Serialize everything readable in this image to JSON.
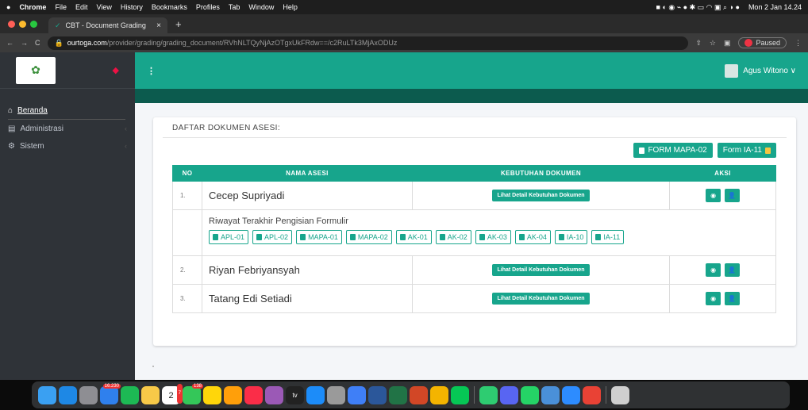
{
  "os_menu": {
    "items": [
      "Chrome",
      "File",
      "Edit",
      "View",
      "History",
      "Bookmarks",
      "Profiles",
      "Tab",
      "Window",
      "Help"
    ],
    "datetime": "Mon 2 Jan 14.24"
  },
  "browser": {
    "tab_title": "CBT - Document Grading",
    "url_domain": "ourtoga.com",
    "url_path": "/provider/grading/grading_document/RVhNLTQyNjAzOTgxUkFRdw==/c2RuLTk3MjAxODUz",
    "paused_label": "Paused"
  },
  "sidebar": {
    "items": [
      {
        "label": "Beranda"
      },
      {
        "label": "Administrasi"
      },
      {
        "label": "Sistem"
      }
    ]
  },
  "header": {
    "menu_glyph": "⋮",
    "user_name": "Agus Witono ∨"
  },
  "card": {
    "title": "DAFTAR DOKUMEN ASESI:",
    "btn_mapa": "FORM MAPA-02",
    "btn_ia": "Form IA-11"
  },
  "table": {
    "headers": [
      "NO",
      "NAMA ASESI",
      "KEBUTUHAN DOKUMEN",
      "AKSI"
    ],
    "rows": [
      {
        "no": "1.",
        "name": "Cecep Supriyadi",
        "need": "Lihat Detail Kebutuhan Dokumen"
      },
      {
        "no": "2.",
        "name": "Riyan Febriyansyah",
        "need": "Lihat Detail Kebutuhan Dokumen"
      },
      {
        "no": "3.",
        "name": "Tatang Edi Setiadi",
        "need": "Lihat Detail Kebutuhan Dokumen"
      }
    ],
    "history": {
      "title": "Riwayat Terakhir Pengisian Formulir",
      "forms": [
        "APL-01",
        "APL-02",
        "MAPA-01",
        "MAPA-02",
        "AK-01",
        "AK-02",
        "AK-03",
        "AK-04",
        "IA-10",
        "IA-11"
      ]
    }
  },
  "dock": {
    "badges": [
      "16.230",
      "7",
      "138"
    ],
    "calendar_day": "2",
    "tv_label": "tv"
  },
  "colors": {
    "accent": "#17a58c",
    "accent_dark": "#0c5b4e",
    "sidebar_bg": "#2f3338"
  }
}
